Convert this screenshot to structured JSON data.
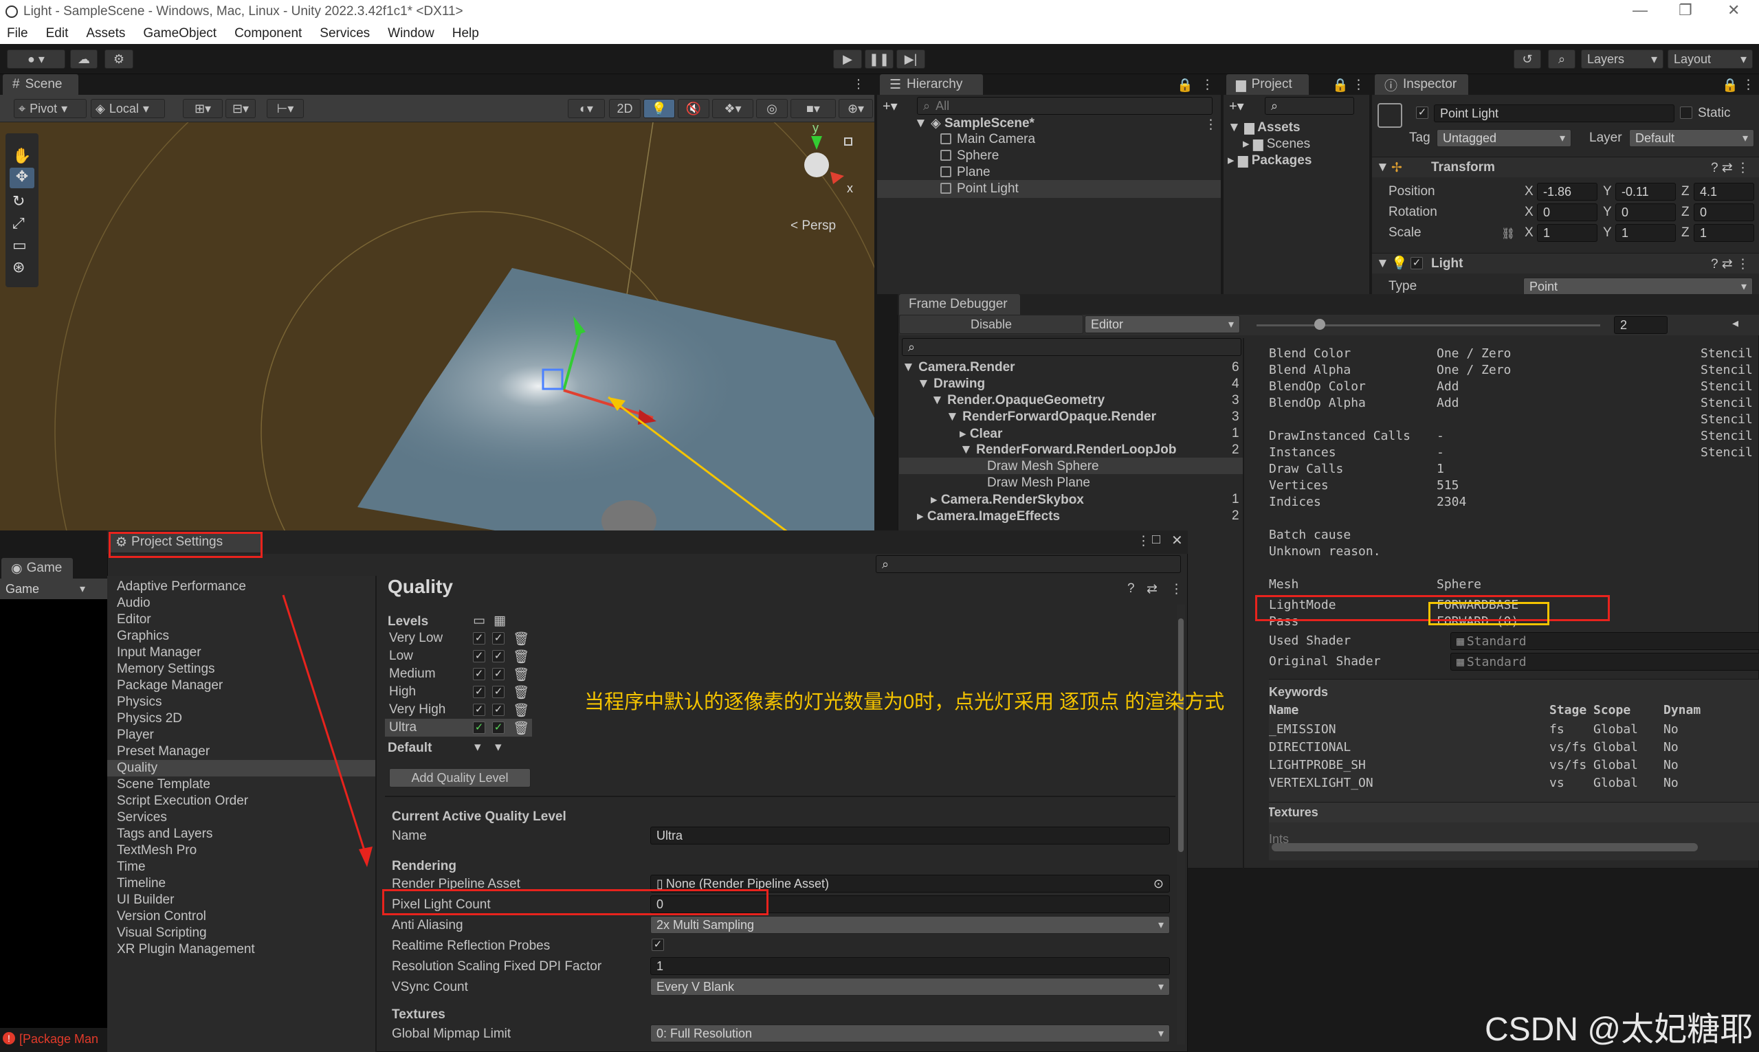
{
  "window": {
    "title": "Light - SampleScene - Windows, Mac, Linux - Unity 2022.3.42f1c1* <DX11>",
    "controls": [
      "—",
      "❐",
      "✕"
    ]
  },
  "menu": [
    "File",
    "Edit",
    "Assets",
    "GameObject",
    "Component",
    "Services",
    "Window",
    "Help"
  ],
  "toolbar": {
    "layers": "Layers",
    "layout": "Layout"
  },
  "scene": {
    "tab": "Scene",
    "pivot": "Pivot",
    "local": "Local",
    "mode_2d": "2D",
    "persp": "< Persp",
    "gizmo_y": "y",
    "gizmo_x": "x"
  },
  "hierarchy": {
    "tab": "Hierarchy",
    "search_placeholder": "All",
    "scene_name": "SampleScene*",
    "items": [
      "Main Camera",
      "Sphere",
      "Plane",
      "Point Light"
    ]
  },
  "project": {
    "tab": "Project",
    "assets": "Assets",
    "scenes": "Scenes",
    "packages": "Packages"
  },
  "inspector": {
    "tab": "Inspector",
    "object_name": "Point Light",
    "static_label": "Static",
    "tag_label": "Tag",
    "tag_value": "Untagged",
    "layer_label": "Layer",
    "layer_value": "Default",
    "transform_title": "Transform",
    "position_label": "Position",
    "rotation_label": "Rotation",
    "scale_label": "Scale",
    "position": {
      "x": "-1.86",
      "y": "-0.11",
      "z": "4.1"
    },
    "rotation": {
      "x": "0",
      "y": "0",
      "z": "0"
    },
    "scale": {
      "x": "1",
      "y": "1",
      "z": "1"
    },
    "light_title": "Light",
    "type_label": "Type",
    "type_value": "Point"
  },
  "frame_debugger": {
    "tab": "Frame Debugger",
    "disable": "Disable",
    "target": "Editor",
    "event_index": "2",
    "tree": [
      {
        "label": "Camera.Render",
        "count": "6"
      },
      {
        "label": "Drawing",
        "count": "4"
      },
      {
        "label": "Render.OpaqueGeometry",
        "count": "3"
      },
      {
        "label": "RenderForwardOpaque.Render",
        "count": "3"
      },
      {
        "label": "Clear",
        "count": "1"
      },
      {
        "label": "RenderForward.RenderLoopJob",
        "count": "2"
      },
      {
        "label": "Draw Mesh Sphere",
        "count": ""
      },
      {
        "label": "Draw Mesh Plane",
        "count": ""
      },
      {
        "label": "Camera.RenderSkybox",
        "count": "1"
      },
      {
        "label": "Camera.ImageEffects",
        "count": "2"
      }
    ],
    "details": [
      {
        "k": "Blend Color",
        "v": "One / Zero",
        "s": "Stencil"
      },
      {
        "k": "Blend Alpha",
        "v": "One / Zero",
        "s": "Stencil"
      },
      {
        "k": "BlendOp Color",
        "v": "Add",
        "s": "Stencil"
      },
      {
        "k": "BlendOp Alpha",
        "v": "Add",
        "s": "Stencil"
      },
      {
        "k": "",
        "v": "",
        "s": "Stencil"
      },
      {
        "k": "DrawInstanced Calls",
        "v": "-",
        "s": "Stencil"
      },
      {
        "k": "Instances",
        "v": "-",
        "s": "Stencil"
      },
      {
        "k": "Draw Calls",
        "v": "1",
        "s": ""
      },
      {
        "k": "Vertices",
        "v": "515",
        "s": ""
      },
      {
        "k": "Indices",
        "v": "2304",
        "s": ""
      }
    ],
    "batch_cause": "Batch cause",
    "batch_reason": "Unknown reason.",
    "mesh_label": "Mesh",
    "mesh_value": "Sphere",
    "lightmode_label": "LightMode",
    "lightmode_value": "FORWARDBASE",
    "pass_label": "Pass",
    "pass_value": "FORWARD (0)",
    "used_shader_label": "Used Shader",
    "used_shader_value": "Standard",
    "orig_shader_label": "Original Shader",
    "orig_shader_value": "Standard",
    "keywords_title": "Keywords",
    "kw_headers": [
      "Name",
      "Stage",
      "Scope",
      "Dynam"
    ],
    "keywords": [
      {
        "name": "_EMISSION",
        "stage": "fs",
        "scope": "Global",
        "dyn": "No"
      },
      {
        "name": "DIRECTIONAL",
        "stage": "vs/fs",
        "scope": "Global",
        "dyn": "No"
      },
      {
        "name": "LIGHTPROBE_SH",
        "stage": "vs/fs",
        "scope": "Global",
        "dyn": "No"
      },
      {
        "name": "VERTEXLIGHT_ON",
        "stage": "vs",
        "scope": "Global",
        "dyn": "No"
      }
    ],
    "textures": "Textures",
    "ints": "Ints"
  },
  "game": {
    "tab": "Game",
    "dropdown": "Game",
    "status": "[Package Man"
  },
  "project_settings": {
    "title": "Project Settings",
    "nav": [
      "Adaptive Performance",
      "Audio",
      "Editor",
      "Graphics",
      "Input Manager",
      "Memory Settings",
      "Package Manager",
      "Physics",
      "Physics 2D",
      "Player",
      "Preset Manager",
      "Quality",
      "Scene Template",
      "Script Execution Order",
      "Services",
      "Tags and Layers",
      "TextMesh Pro",
      "Time",
      "Timeline",
      "UI Builder",
      "Version Control",
      "Visual Scripting",
      "XR Plugin Management"
    ],
    "section_title": "Quality",
    "levels_label": "Levels",
    "levels": [
      "Very Low",
      "Low",
      "Medium",
      "High",
      "Very High",
      "Ultra"
    ],
    "default_label": "Default",
    "add_level": "Add Quality Level",
    "current_active": "Current Active Quality Level",
    "name_label": "Name",
    "name_value": "Ultra",
    "rendering": "Rendering",
    "rpa_label": "Render Pipeline Asset",
    "rpa_value": "None (Render Pipeline Asset)",
    "plc_label": "Pixel Light Count",
    "plc_value": "0",
    "aa_label": "Anti Aliasing",
    "aa_value": "2x Multi Sampling",
    "rrp_label": "Realtime Reflection Probes",
    "rsf_label": "Resolution Scaling Fixed DPI Factor",
    "rsf_value": "1",
    "vsync_label": "VSync Count",
    "vsync_value": "Every V Blank",
    "textures": "Textures",
    "gml_label": "Global Mipmap Limit",
    "gml_value": "0: Full Resolution"
  },
  "annotation": "当程序中默认的逐像素的灯光数量为0时，点光灯采用 逐顶点 的渲染方式",
  "watermark": "CSDN @太妃糖耶",
  "colors": {
    "accent_red": "#e8231d",
    "annotation_yellow": "#f5c400",
    "selected": "#2c5d87"
  }
}
